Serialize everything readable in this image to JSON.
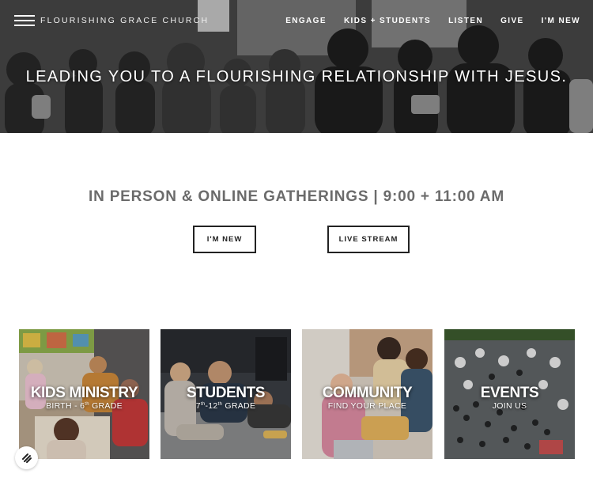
{
  "header": {
    "logo_text": "FLOURISHING GRACE CHURCH",
    "nav": [
      "ENGAGE",
      "KIDS + STUDENTS",
      "LISTEN",
      "GIVE",
      "I'M NEW"
    ]
  },
  "hero": {
    "title": "LEADING YOU TO A FLOURISHING RELATIONSHIP WITH JESUS."
  },
  "gatherings": {
    "heading": "IN PERSON & ONLINE GATHERINGS | 9:00 + 11:00 AM",
    "buttons": [
      "I'M NEW",
      "LIVE STREAM"
    ]
  },
  "tiles": [
    {
      "title": "KIDS MINISTRY",
      "sub_a": "BIRTH - 6",
      "sub_sup": "th",
      "sub_b": " GRADE"
    },
    {
      "title": "STUDENTS",
      "sub_a": "7",
      "sub_sup": "th",
      "sub_b": "-12",
      "sub_sup2": "th",
      "sub_c": " GRADE"
    },
    {
      "title": "COMMUNITY",
      "sub": "FIND YOUR PLACE"
    },
    {
      "title": "EVENTS",
      "sub": "JOIN US"
    }
  ],
  "colors": {
    "accent_text": "#6b6b6b",
    "button_border": "#222222"
  },
  "icons": [
    "menu-lines-icon",
    "squarespace-icon"
  ]
}
